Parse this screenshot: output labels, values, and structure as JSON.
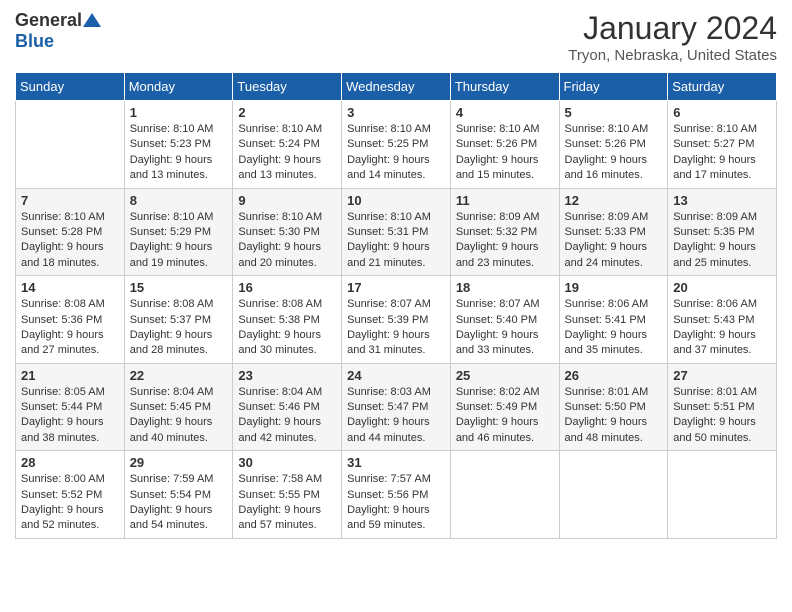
{
  "logo": {
    "line1": "General",
    "line2": "Blue"
  },
  "title": "January 2024",
  "subtitle": "Tryon, Nebraska, United States",
  "headers": [
    "Sunday",
    "Monday",
    "Tuesday",
    "Wednesday",
    "Thursday",
    "Friday",
    "Saturday"
  ],
  "weeks": [
    [
      {
        "day": "",
        "info": ""
      },
      {
        "day": "1",
        "info": "Sunrise: 8:10 AM\nSunset: 5:23 PM\nDaylight: 9 hours\nand 13 minutes."
      },
      {
        "day": "2",
        "info": "Sunrise: 8:10 AM\nSunset: 5:24 PM\nDaylight: 9 hours\nand 13 minutes."
      },
      {
        "day": "3",
        "info": "Sunrise: 8:10 AM\nSunset: 5:25 PM\nDaylight: 9 hours\nand 14 minutes."
      },
      {
        "day": "4",
        "info": "Sunrise: 8:10 AM\nSunset: 5:26 PM\nDaylight: 9 hours\nand 15 minutes."
      },
      {
        "day": "5",
        "info": "Sunrise: 8:10 AM\nSunset: 5:26 PM\nDaylight: 9 hours\nand 16 minutes."
      },
      {
        "day": "6",
        "info": "Sunrise: 8:10 AM\nSunset: 5:27 PM\nDaylight: 9 hours\nand 17 minutes."
      }
    ],
    [
      {
        "day": "7",
        "info": "Sunrise: 8:10 AM\nSunset: 5:28 PM\nDaylight: 9 hours\nand 18 minutes."
      },
      {
        "day": "8",
        "info": "Sunrise: 8:10 AM\nSunset: 5:29 PM\nDaylight: 9 hours\nand 19 minutes."
      },
      {
        "day": "9",
        "info": "Sunrise: 8:10 AM\nSunset: 5:30 PM\nDaylight: 9 hours\nand 20 minutes."
      },
      {
        "day": "10",
        "info": "Sunrise: 8:10 AM\nSunset: 5:31 PM\nDaylight: 9 hours\nand 21 minutes."
      },
      {
        "day": "11",
        "info": "Sunrise: 8:09 AM\nSunset: 5:32 PM\nDaylight: 9 hours\nand 23 minutes."
      },
      {
        "day": "12",
        "info": "Sunrise: 8:09 AM\nSunset: 5:33 PM\nDaylight: 9 hours\nand 24 minutes."
      },
      {
        "day": "13",
        "info": "Sunrise: 8:09 AM\nSunset: 5:35 PM\nDaylight: 9 hours\nand 25 minutes."
      }
    ],
    [
      {
        "day": "14",
        "info": "Sunrise: 8:08 AM\nSunset: 5:36 PM\nDaylight: 9 hours\nand 27 minutes."
      },
      {
        "day": "15",
        "info": "Sunrise: 8:08 AM\nSunset: 5:37 PM\nDaylight: 9 hours\nand 28 minutes."
      },
      {
        "day": "16",
        "info": "Sunrise: 8:08 AM\nSunset: 5:38 PM\nDaylight: 9 hours\nand 30 minutes."
      },
      {
        "day": "17",
        "info": "Sunrise: 8:07 AM\nSunset: 5:39 PM\nDaylight: 9 hours\nand 31 minutes."
      },
      {
        "day": "18",
        "info": "Sunrise: 8:07 AM\nSunset: 5:40 PM\nDaylight: 9 hours\nand 33 minutes."
      },
      {
        "day": "19",
        "info": "Sunrise: 8:06 AM\nSunset: 5:41 PM\nDaylight: 9 hours\nand 35 minutes."
      },
      {
        "day": "20",
        "info": "Sunrise: 8:06 AM\nSunset: 5:43 PM\nDaylight: 9 hours\nand 37 minutes."
      }
    ],
    [
      {
        "day": "21",
        "info": "Sunrise: 8:05 AM\nSunset: 5:44 PM\nDaylight: 9 hours\nand 38 minutes."
      },
      {
        "day": "22",
        "info": "Sunrise: 8:04 AM\nSunset: 5:45 PM\nDaylight: 9 hours\nand 40 minutes."
      },
      {
        "day": "23",
        "info": "Sunrise: 8:04 AM\nSunset: 5:46 PM\nDaylight: 9 hours\nand 42 minutes."
      },
      {
        "day": "24",
        "info": "Sunrise: 8:03 AM\nSunset: 5:47 PM\nDaylight: 9 hours\nand 44 minutes."
      },
      {
        "day": "25",
        "info": "Sunrise: 8:02 AM\nSunset: 5:49 PM\nDaylight: 9 hours\nand 46 minutes."
      },
      {
        "day": "26",
        "info": "Sunrise: 8:01 AM\nSunset: 5:50 PM\nDaylight: 9 hours\nand 48 minutes."
      },
      {
        "day": "27",
        "info": "Sunrise: 8:01 AM\nSunset: 5:51 PM\nDaylight: 9 hours\nand 50 minutes."
      }
    ],
    [
      {
        "day": "28",
        "info": "Sunrise: 8:00 AM\nSunset: 5:52 PM\nDaylight: 9 hours\nand 52 minutes."
      },
      {
        "day": "29",
        "info": "Sunrise: 7:59 AM\nSunset: 5:54 PM\nDaylight: 9 hours\nand 54 minutes."
      },
      {
        "day": "30",
        "info": "Sunrise: 7:58 AM\nSunset: 5:55 PM\nDaylight: 9 hours\nand 57 minutes."
      },
      {
        "day": "31",
        "info": "Sunrise: 7:57 AM\nSunset: 5:56 PM\nDaylight: 9 hours\nand 59 minutes."
      },
      {
        "day": "",
        "info": ""
      },
      {
        "day": "",
        "info": ""
      },
      {
        "day": "",
        "info": ""
      }
    ]
  ]
}
